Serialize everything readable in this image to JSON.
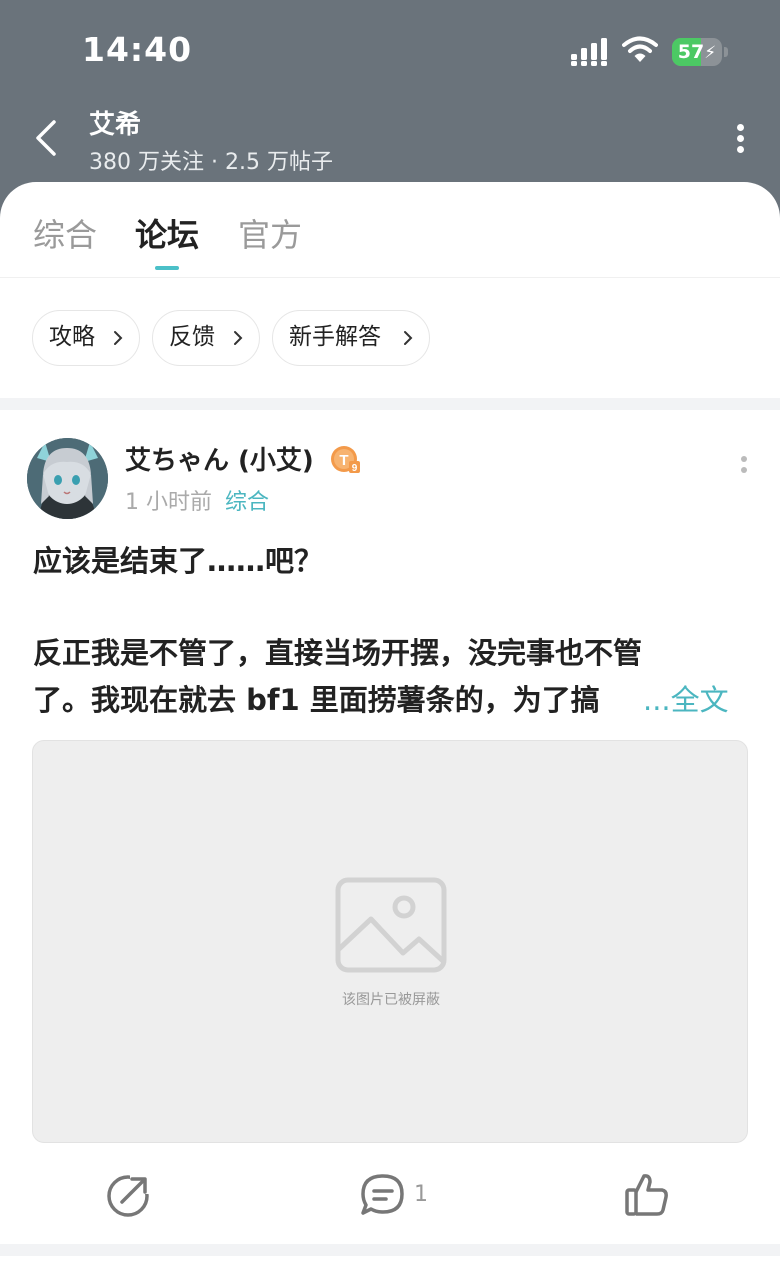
{
  "status_bar": {
    "time": "14:40",
    "battery_percent": 57,
    "battery_label": "57",
    "signal_icon": "cellular-signal-icon",
    "wifi_icon": "wifi-icon",
    "battery_icon": "battery-charging-icon"
  },
  "header": {
    "title": "艾希",
    "stats": "380 万关注 · 2.5 万帖子",
    "back_icon": "chevron-left-icon",
    "more_icon": "more-vertical-icon"
  },
  "tabs": [
    {
      "label": "综合",
      "active": false
    },
    {
      "label": "论坛",
      "active": true
    },
    {
      "label": "官方",
      "active": false
    }
  ],
  "chips": [
    {
      "label": "攻略"
    },
    {
      "label": "反馈"
    },
    {
      "label": "新手解答"
    }
  ],
  "post": {
    "author": "艾ちゃん (小艾)",
    "time": "1 小时前",
    "channel": "综合",
    "title": "应该是结束了……吧？",
    "body_line1": "反正我是不管了，直接当场开摆，没完事也不管",
    "body_line2": "了。我现在就去 bf1 里面捞薯条的，为了搞",
    "read_more": "...全文",
    "image_blocked_text": "该图片已被屏蔽",
    "comment_count": "1"
  },
  "colors": {
    "header_bg": "#6a737b",
    "accent": "#4bc0c8",
    "battery_green": "#4cc964",
    "badge_orange": "#f39a4a"
  }
}
